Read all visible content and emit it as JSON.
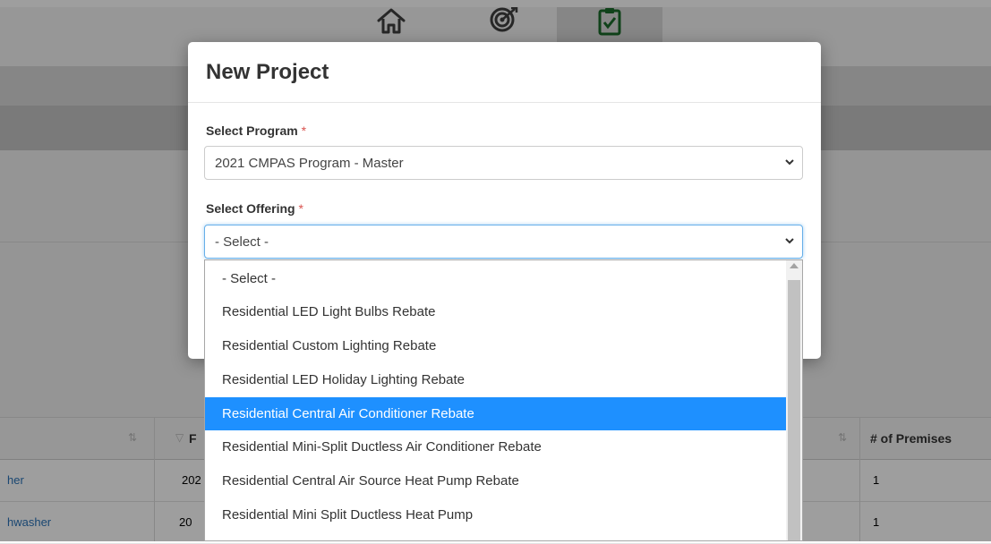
{
  "nav": {
    "icons": [
      "home-icon",
      "target-icon",
      "clipboard-icon"
    ],
    "active": "clipboard-icon"
  },
  "table": {
    "headers": {
      "col4": "# of Premises"
    },
    "rows": [
      {
        "name_partial": "her",
        "date_partial": "202",
        "premises": "1"
      },
      {
        "name_partial": "hwasher",
        "date_partial": "20",
        "premises": "1"
      }
    ],
    "col2_header_partial": "F"
  },
  "modal": {
    "title": "New Project",
    "program": {
      "label": "Select Program",
      "required_mark": "*",
      "value": "2021 CMPAS Program - Master"
    },
    "offering": {
      "label": "Select Offering",
      "required_mark": "*",
      "value": "- Select -"
    }
  },
  "dropdown": {
    "options": [
      "- Select -",
      "Residential LED Light Bulbs Rebate",
      "Residential Custom Lighting Rebate",
      "Residential LED Holiday Lighting Rebate",
      "Residential Central Air Conditioner Rebate",
      "Residential Mini-Split Ductless Air Conditioner Rebate",
      "Residential Central Air Source Heat Pump Rebate",
      "Residential Mini Split Ductless Heat Pump"
    ],
    "highlighted_index": 4
  },
  "colors": {
    "highlight": "#1e90ff",
    "required": "#d9534f",
    "link": "#2a73b8",
    "nav_icon": "#4a4a4a",
    "nav_icon_active": "#1a6b2a"
  }
}
